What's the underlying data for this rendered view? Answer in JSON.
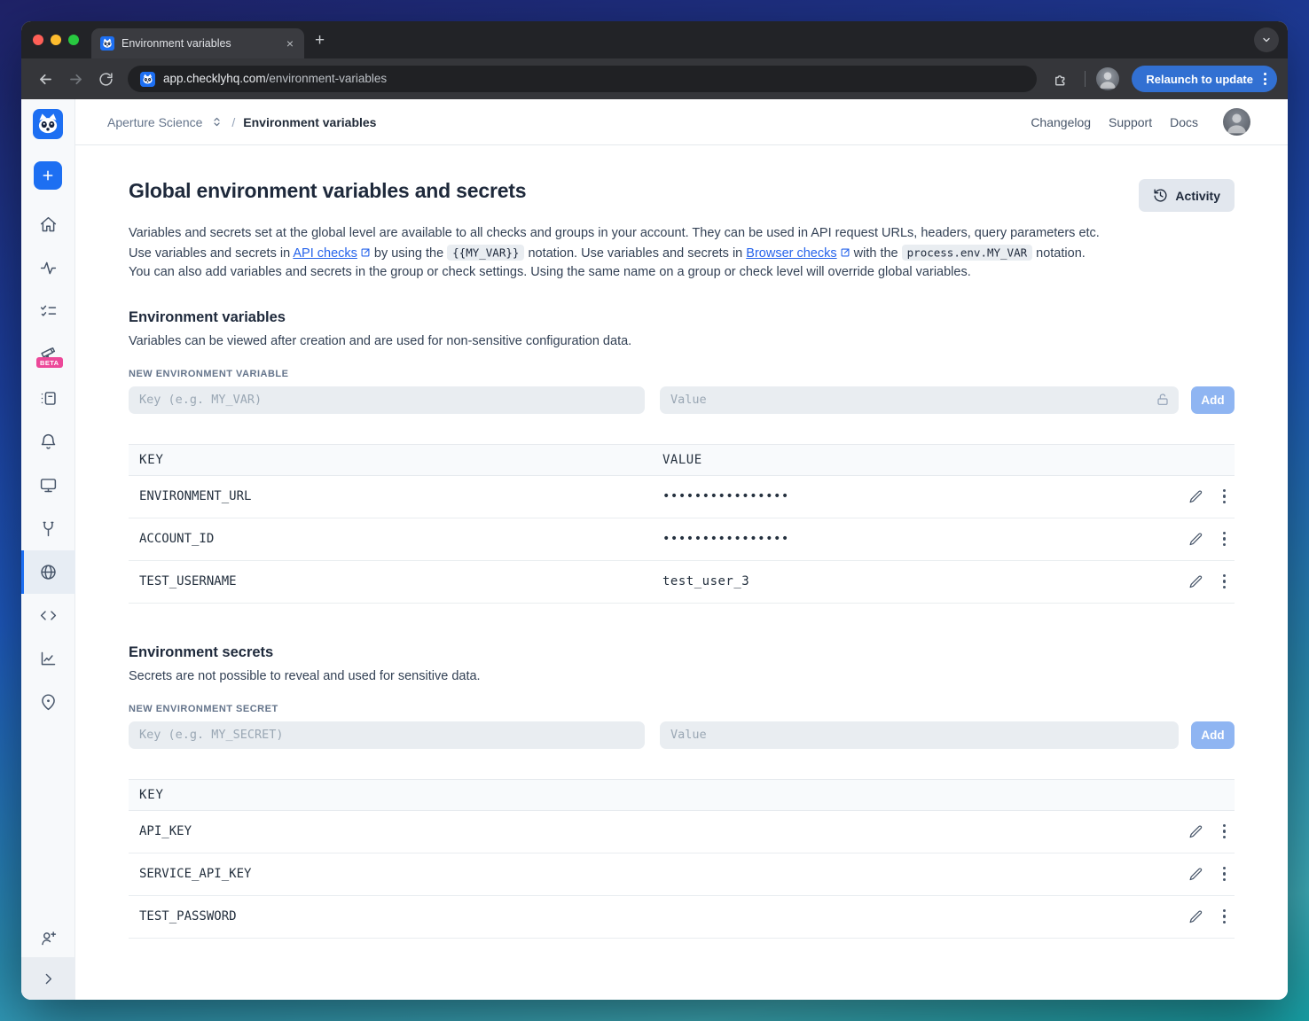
{
  "browser": {
    "tab_title": "Environment variables",
    "close_tab": "×",
    "new_tab": "+",
    "url_domain": "app.checklyhq.com",
    "url_path": "/environment-variables",
    "relaunch_label": "Relaunch to update",
    "traffic_colors": {
      "close": "#ff5f57",
      "minimize": "#febc2e",
      "zoom": "#28c840"
    }
  },
  "header": {
    "account_name": "Aperture Science",
    "separator": "/",
    "current": "Environment variables",
    "links": [
      "Changelog",
      "Support",
      "Docs"
    ]
  },
  "sidebar": {
    "beta_badge": "BETA",
    "active_item": "globe",
    "icons": [
      "checkly-logo",
      "plus",
      "home",
      "pulse",
      "checklist",
      "telescope",
      "run-log",
      "bell",
      "monitor",
      "wrench",
      "globe",
      "code",
      "chart",
      "map-pin",
      "user-plus",
      "chevron-right"
    ]
  },
  "page": {
    "title": "Global environment variables and secrets",
    "activity_button": "Activity",
    "intro": [
      {
        "type": "text",
        "text": "Variables and secrets set at the global level are available to all checks and groups in your account. They can be used in API request URLs, headers, query parameters etc. Use variables and secrets in "
      },
      {
        "type": "link",
        "text": "API checks"
      },
      {
        "type": "text",
        "text": " by using the "
      },
      {
        "type": "code",
        "text": "{{MY_VAR}}"
      },
      {
        "type": "text",
        "text": " notation. Use variables and secrets in "
      },
      {
        "type": "link",
        "text": "Browser checks"
      },
      {
        "type": "text",
        "text": " with the "
      },
      {
        "type": "code",
        "text": "process.env.MY_VAR"
      },
      {
        "type": "text",
        "text": " notation. You can also add variables and secrets in the group or check settings. Using the same name on a group or check level will override global variables."
      }
    ]
  },
  "variables_section": {
    "heading": "Environment variables",
    "description": "Variables can be viewed after creation and are used for non-sensitive configuration data.",
    "form_label": "NEW ENVIRONMENT VARIABLE",
    "key_placeholder": "Key (e.g. MY_VAR)",
    "value_placeholder": "Value",
    "add_button": "Add",
    "columns": {
      "key": "KEY",
      "value": "VALUE"
    },
    "rows": [
      {
        "key": "ENVIRONMENT_URL",
        "value": "••••••••••••••••"
      },
      {
        "key": "ACCOUNT_ID",
        "value": "••••••••••••••••"
      },
      {
        "key": "TEST_USERNAME",
        "value": "test_user_3"
      }
    ]
  },
  "secrets_section": {
    "heading": "Environment secrets",
    "description": "Secrets are not possible to reveal and used for sensitive data.",
    "form_label": "NEW ENVIRONMENT SECRET",
    "key_placeholder": "Key (e.g. MY_SECRET)",
    "value_placeholder": "Value",
    "add_button": "Add",
    "columns": {
      "key": "KEY"
    },
    "rows": [
      {
        "key": "API_KEY"
      },
      {
        "key": "SERVICE_API_KEY"
      },
      {
        "key": "TEST_PASSWORD"
      }
    ]
  },
  "colors": {
    "accent_blue": "#1d6ff2",
    "link_blue": "#2563eb",
    "beta_pink": "#ec4899",
    "add_button_blue": "#8fb5f2",
    "relaunch_blue": "#3270d2"
  }
}
